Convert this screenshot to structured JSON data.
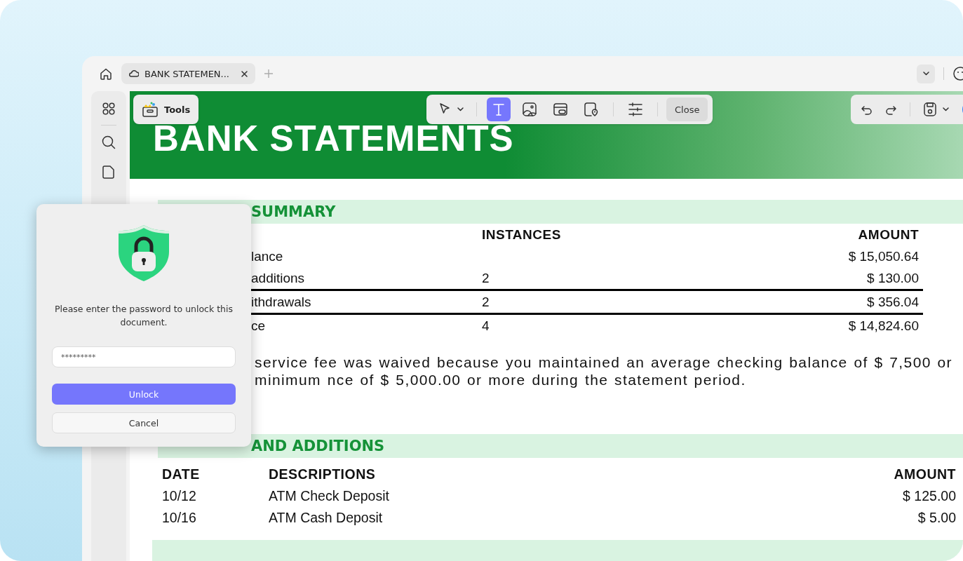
{
  "tabs": [
    {
      "title": "BANK STATEMEN...",
      "selected": true
    }
  ],
  "tools_button": {
    "label": "Tools"
  },
  "edit_toolbar": {
    "tools": [
      {
        "selected": false
      },
      {
        "selected": true
      },
      {
        "selected": false
      },
      {
        "selected": false
      },
      {
        "selected": false
      },
      {
        "selected": false
      }
    ],
    "close_label": "Close"
  },
  "document": {
    "title": "BANK STATEMENTS",
    "summary": {
      "heading": "SUMMARY",
      "columns": [
        "INSTANCES",
        "AMOUNT"
      ],
      "rows": [
        {
          "label": "lance",
          "amount": "$ 15,050.64",
          "rule_below": false
        },
        {
          "label": "additions",
          "instances": "2",
          "amount": "$ 130.00",
          "rule_below": true
        },
        {
          "label": "ithdrawals",
          "instances": "2",
          "amount": "$ 356.04",
          "rule_below": true
        },
        {
          "label": "ce",
          "instances": "4",
          "amount": "$ 14,824.60",
          "rule_below": false
        }
      ],
      "note": "service fee was waived because you maintained an average checking balance of $ 7,500 or minimum nce of $ 5,000.00 or more during the statement period."
    },
    "deposits": {
      "heading": "AND ADDITIONS",
      "columns": [
        "DATE",
        "DESCRIPTIONS",
        "AMOUNT"
      ],
      "rows": [
        {
          "date": "10/12",
          "description": "ATM Check Deposit",
          "amount": "$ 125.00"
        },
        {
          "date": "10/16",
          "description": "ATM Cash Deposit",
          "amount": "$ 5.00"
        }
      ]
    }
  },
  "dialog": {
    "message": "Please enter the password to unlock this document.",
    "password": "*********",
    "buttons": [
      {
        "label": "Unlock",
        "kind": "primary"
      },
      {
        "label": "Cancel",
        "kind": "secondary"
      }
    ]
  }
}
